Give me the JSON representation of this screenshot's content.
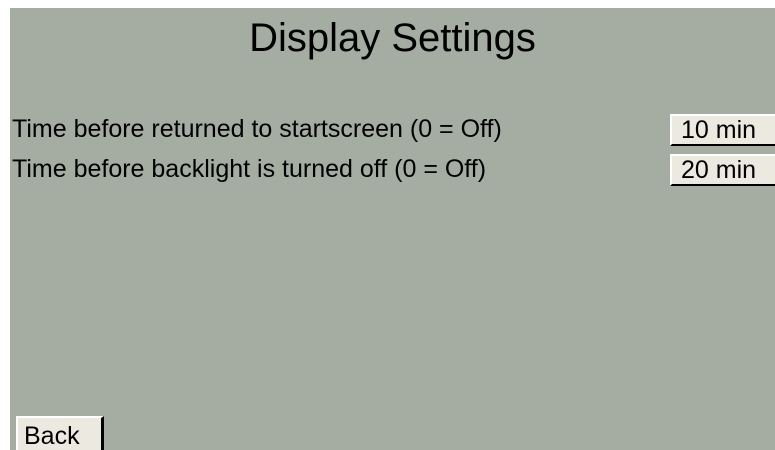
{
  "screen": {
    "title": "Display Settings",
    "background_color": "#a5aca2",
    "button_color": "#ece9e1"
  },
  "settings": [
    {
      "label": "Time before returned to startscreen (0 = Off)",
      "value": "10 min"
    },
    {
      "label": "Time before backlight is turned off (0 = Off)",
      "value": "20 min"
    }
  ],
  "footer": {
    "back_label": "Back"
  }
}
